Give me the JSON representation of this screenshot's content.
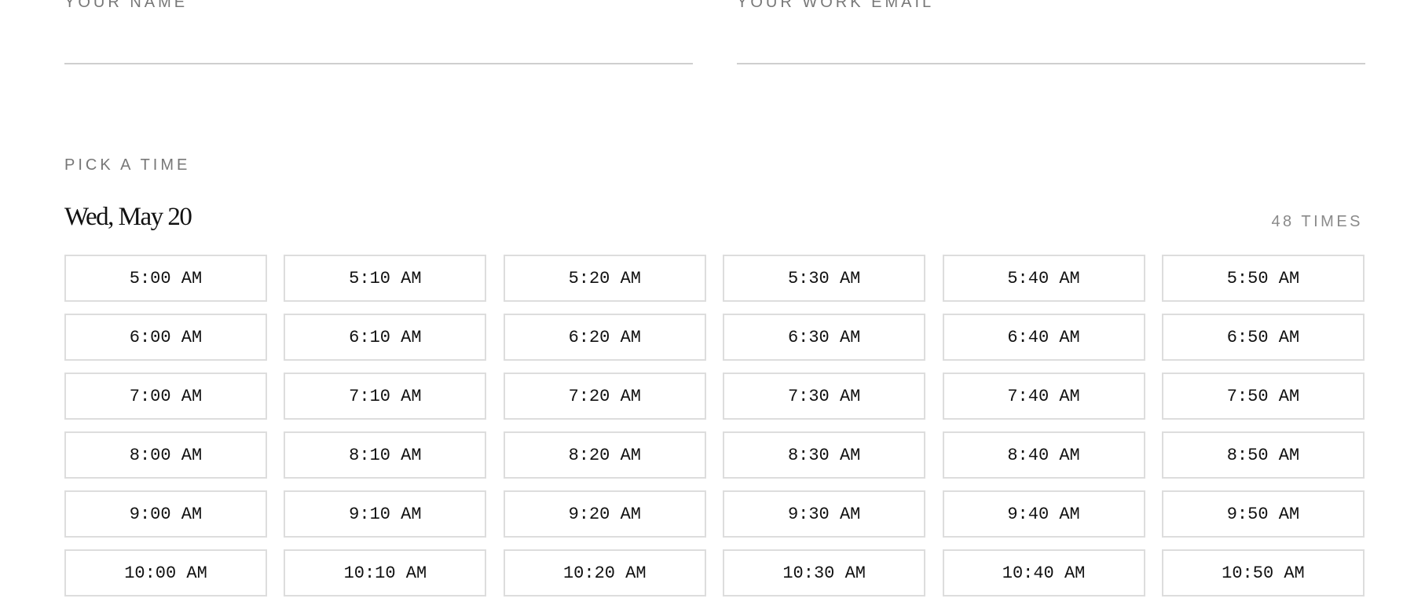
{
  "form": {
    "name_label": "YOUR NAME",
    "name_value": "",
    "email_label": "YOUR WORK EMAIL",
    "email_value": ""
  },
  "picker": {
    "section_label": "PICK A TIME",
    "date": "Wed, May 20",
    "count_label": "48 TIMES",
    "slots": [
      "5:00 AM",
      "5:10 AM",
      "5:20 AM",
      "5:30 AM",
      "5:40 AM",
      "5:50 AM",
      "6:00 AM",
      "6:10 AM",
      "6:20 AM",
      "6:30 AM",
      "6:40 AM",
      "6:50 AM",
      "7:00 AM",
      "7:10 AM",
      "7:20 AM",
      "7:30 AM",
      "7:40 AM",
      "7:50 AM",
      "8:00 AM",
      "8:10 AM",
      "8:20 AM",
      "8:30 AM",
      "8:40 AM",
      "8:50 AM",
      "9:00 AM",
      "9:10 AM",
      "9:20 AM",
      "9:30 AM",
      "9:40 AM",
      "9:50 AM",
      "10:00 AM",
      "10:10 AM",
      "10:20 AM",
      "10:30 AM",
      "10:40 AM",
      "10:50 AM"
    ]
  }
}
